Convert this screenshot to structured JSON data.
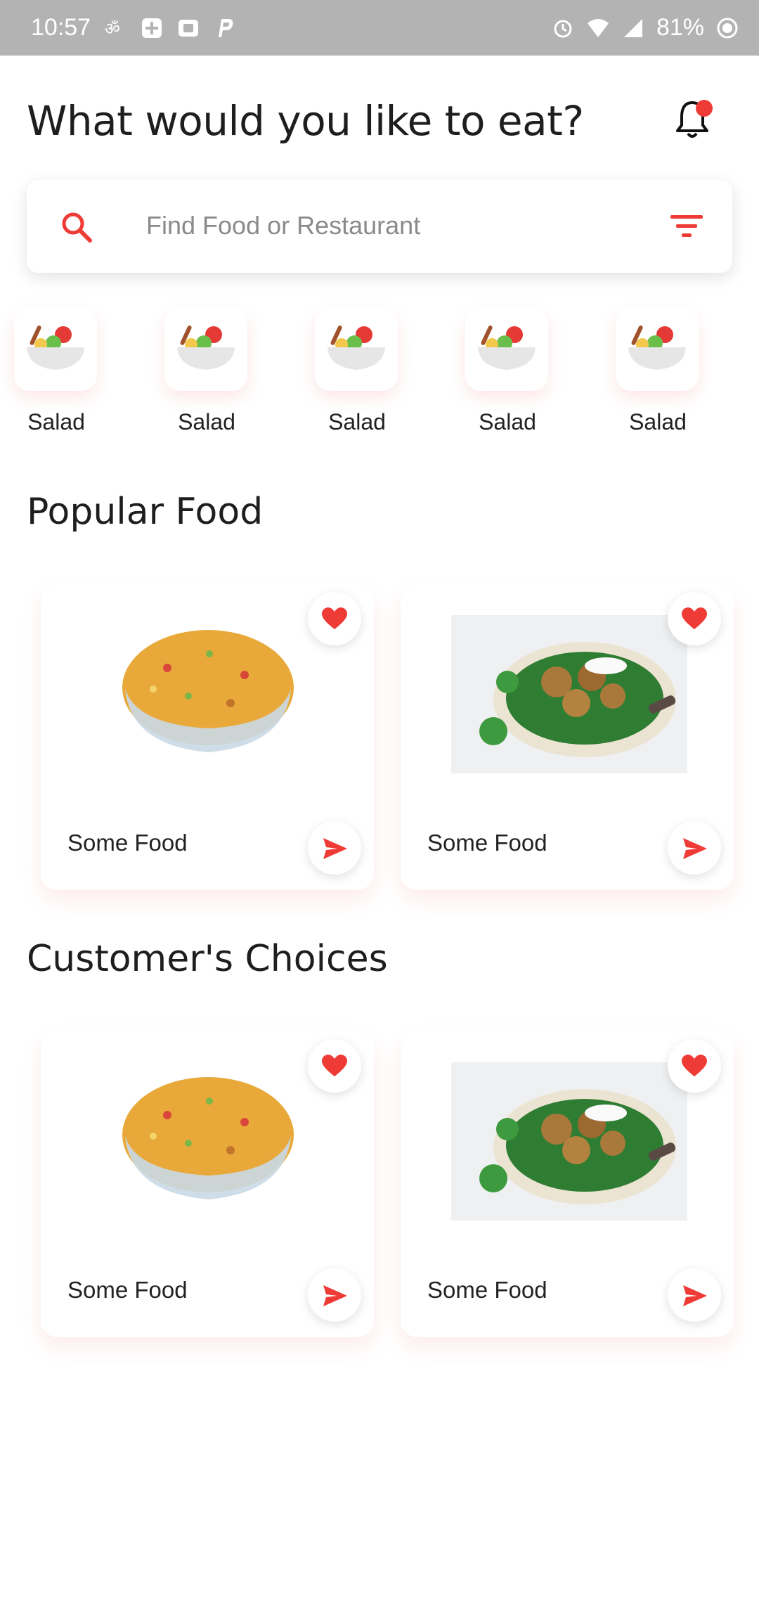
{
  "status_bar": {
    "time": "10:57",
    "battery": "81%",
    "left_icons": [
      "android-app-icon",
      "plus-box-icon",
      "media-icon",
      "p-icon"
    ],
    "right_icons": [
      "alarm-icon",
      "wifi-icon",
      "signal-icon",
      "battery-icon"
    ]
  },
  "header": {
    "title": "What would you like to eat?",
    "notification_icon": "bell-icon",
    "badge_color": "#ef3b36"
  },
  "search": {
    "placeholder": "Find Food or Restaurant",
    "search_icon": "search-icon",
    "filter_icon": "filter-icon"
  },
  "categories": [
    {
      "label": "Salad",
      "icon": "salad-bowl-icon"
    },
    {
      "label": "Salad",
      "icon": "salad-bowl-icon"
    },
    {
      "label": "Salad",
      "icon": "salad-bowl-icon"
    },
    {
      "label": "Salad",
      "icon": "salad-bowl-icon"
    },
    {
      "label": "Salad",
      "icon": "salad-bowl-icon"
    }
  ],
  "popular": {
    "title": "Popular Food",
    "items": [
      {
        "name": "Some Food",
        "image": "snack-mix-bowl"
      },
      {
        "name": "Some Food",
        "image": "falafel-salad-bowl"
      }
    ]
  },
  "choices": {
    "title": "Customer's Choices",
    "items": [
      {
        "name": "Some Food",
        "image": "snack-mix-bowl"
      },
      {
        "name": "Some Food",
        "image": "falafel-salad-bowl"
      }
    ]
  },
  "colors": {
    "accent": "#ef3b36",
    "status_bar": "#b3b3b3",
    "text": "#1e1e1e"
  }
}
